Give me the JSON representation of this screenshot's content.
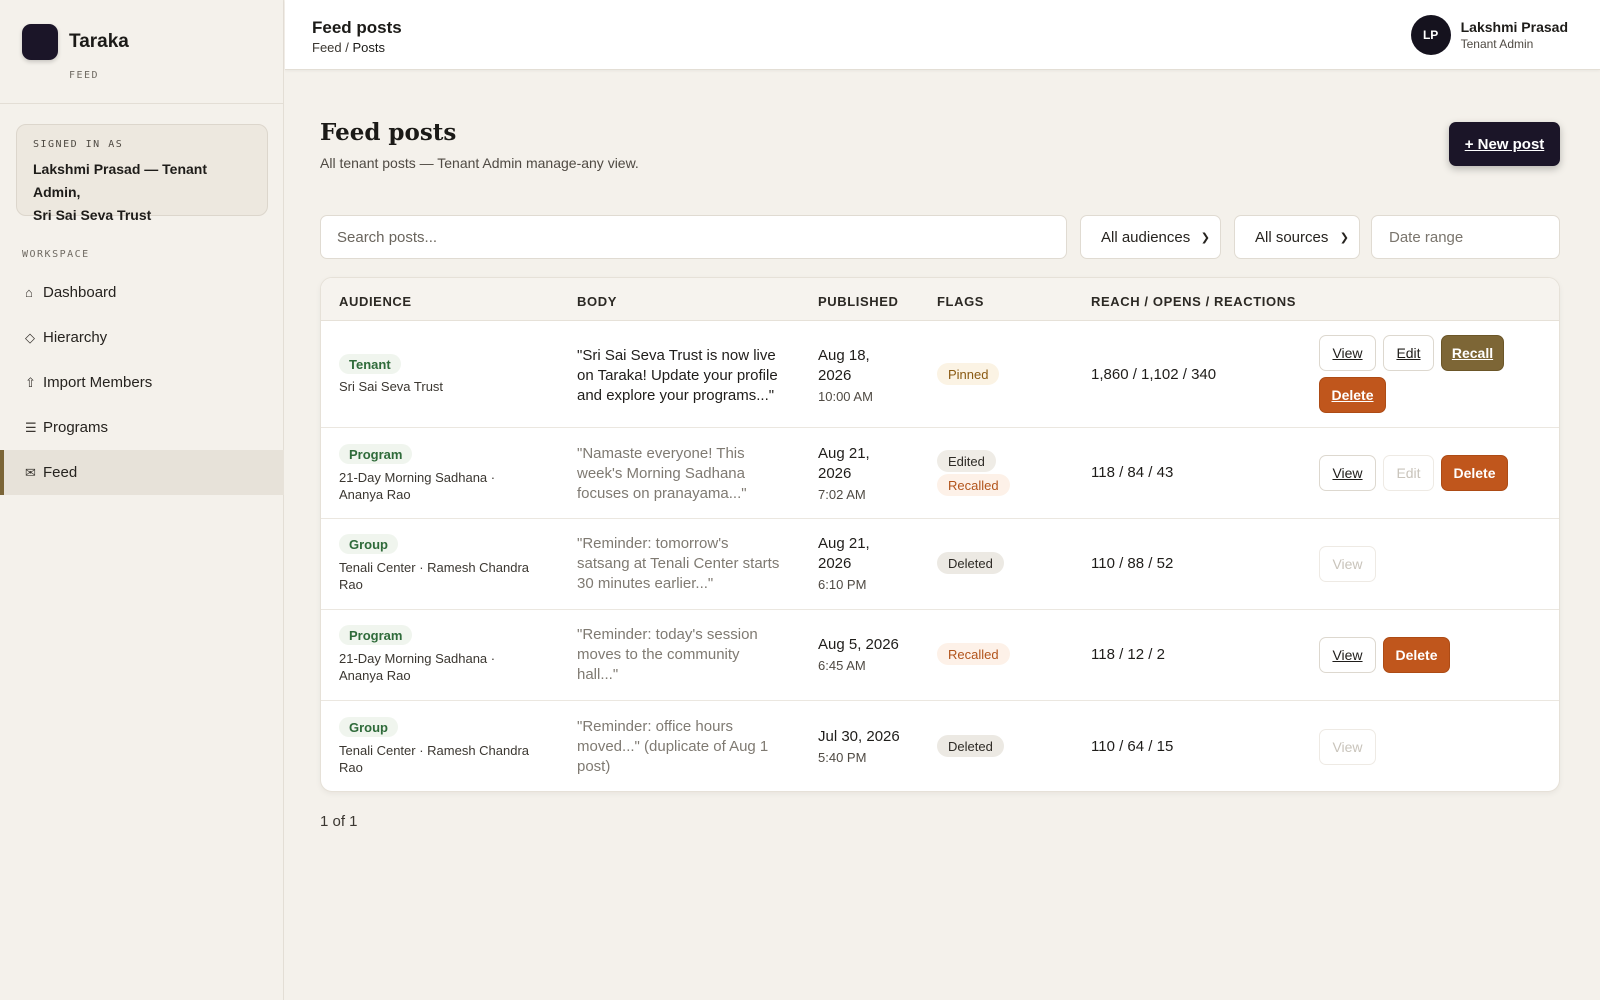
{
  "app": {
    "name": "Taraka",
    "section_label": "FEED"
  },
  "signed_in": {
    "label": "SIGNED IN AS",
    "line1": "Lakshmi Prasad — Tenant Admin,",
    "line2": "Sri Sai Seva Trust"
  },
  "sidebar": {
    "workspace_label": "WORKSPACE",
    "items": [
      {
        "label": "Dashboard",
        "icon": "home-icon",
        "glyph": "⌂"
      },
      {
        "label": "Hierarchy",
        "icon": "diamond-icon",
        "glyph": "◇"
      },
      {
        "label": "Import Members",
        "icon": "upload-icon",
        "glyph": "⇧"
      },
      {
        "label": "Programs",
        "icon": "list-icon",
        "glyph": "☰"
      },
      {
        "label": "Feed",
        "icon": "mail-icon",
        "glyph": "✉",
        "active": true
      }
    ]
  },
  "header": {
    "title": "Feed posts",
    "breadcrumb": {
      "root": "Feed",
      "separator": " / ",
      "current": "Posts"
    },
    "user": {
      "initials": "LP",
      "name": "Lakshmi Prasad",
      "role": "Tenant Admin"
    }
  },
  "page": {
    "title": "Feed posts",
    "subtitle": "All tenant posts — Tenant Admin manage-any view.",
    "new_post_label": "+ New post"
  },
  "filters": {
    "search_placeholder": "Search posts...",
    "audience_select": "All audiences",
    "source_select": "All sources",
    "date_placeholder": "Date range"
  },
  "table": {
    "columns": [
      "AUDIENCE",
      "BODY",
      "PUBLISHED",
      "FLAGS",
      "REACH / OPENS / REACTIONS"
    ],
    "rows": [
      {
        "audience_type": "Tenant",
        "audience_line1": "Sri Sai Seva Trust",
        "audience_line2": "",
        "body_l1": "\"Sri Sai Seva Trust is now live",
        "body_l2": "on Taraka! Update your profile",
        "body_l3": "and explore your programs...\"",
        "date_l1": "Aug 18,",
        "date_l2": "2026",
        "time": "10:00 AM",
        "flags": [
          "Pinned"
        ],
        "metrics": "1,860 / 1,102 / 340",
        "actions": [
          "View",
          "Edit",
          "Recall",
          "Delete"
        ]
      },
      {
        "audience_type": "Program",
        "audience_line1": "21-Day Morning Sadhana ·",
        "audience_line2": "Ananya Rao",
        "body_l1": "\"Namaste everyone! This",
        "body_l2": "week's Morning Sadhana",
        "body_l3": "focuses on pranayama...\"",
        "date_l1": "Aug 21,",
        "date_l2": "2026",
        "time": "7:02 AM",
        "flags": [
          "Edited",
          "Recalled"
        ],
        "metrics": "118 / 84 / 43",
        "actions": [
          "View",
          "Edit",
          "Delete"
        ]
      },
      {
        "audience_type": "Group",
        "audience_line1": "Tenali Center · Ramesh Chandra",
        "audience_line2": "Rao",
        "body_l1": "\"Reminder: tomorrow's",
        "body_l2": "satsang at Tenali Center starts",
        "body_l3": "30 minutes earlier...\"",
        "date_l1": "Aug 21,",
        "date_l2": "2026",
        "time": "6:10 PM",
        "flags": [
          "Deleted"
        ],
        "metrics": "110 / 88 / 52",
        "actions": [
          "View"
        ]
      },
      {
        "audience_type": "Program",
        "audience_line1": "21-Day Morning Sadhana ·",
        "audience_line2": "Ananya Rao",
        "body_l1": "\"Reminder: today's session",
        "body_l2": "moves to the community",
        "body_l3": "hall...\"",
        "date_l1": "Aug 5, 2026",
        "date_l2": "",
        "time": "6:45 AM",
        "flags": [
          "Recalled"
        ],
        "metrics": "118 / 12 / 2",
        "actions": [
          "View",
          "Delete"
        ]
      },
      {
        "audience_type": "Group",
        "audience_line1": "Tenali Center · Ramesh Chandra",
        "audience_line2": "Rao",
        "body_l1": "\"Reminder: office hours",
        "body_l2": "moved...\" (duplicate of Aug 1",
        "body_l3": "post)",
        "date_l1": "Jul 30, 2026",
        "date_l2": "",
        "time": "5:40 PM",
        "flags": [
          "Deleted"
        ],
        "metrics": "110 / 64 / 15",
        "actions": [
          "View"
        ]
      }
    ]
  },
  "pagination": {
    "label": "1 of 1"
  },
  "colors": {
    "brand_dark": "#1b1528",
    "accent_gold": "#7d6636",
    "delete_orange": "#c0561c",
    "audience_green": "#2f6b3a",
    "background": "#f4f1eb"
  }
}
